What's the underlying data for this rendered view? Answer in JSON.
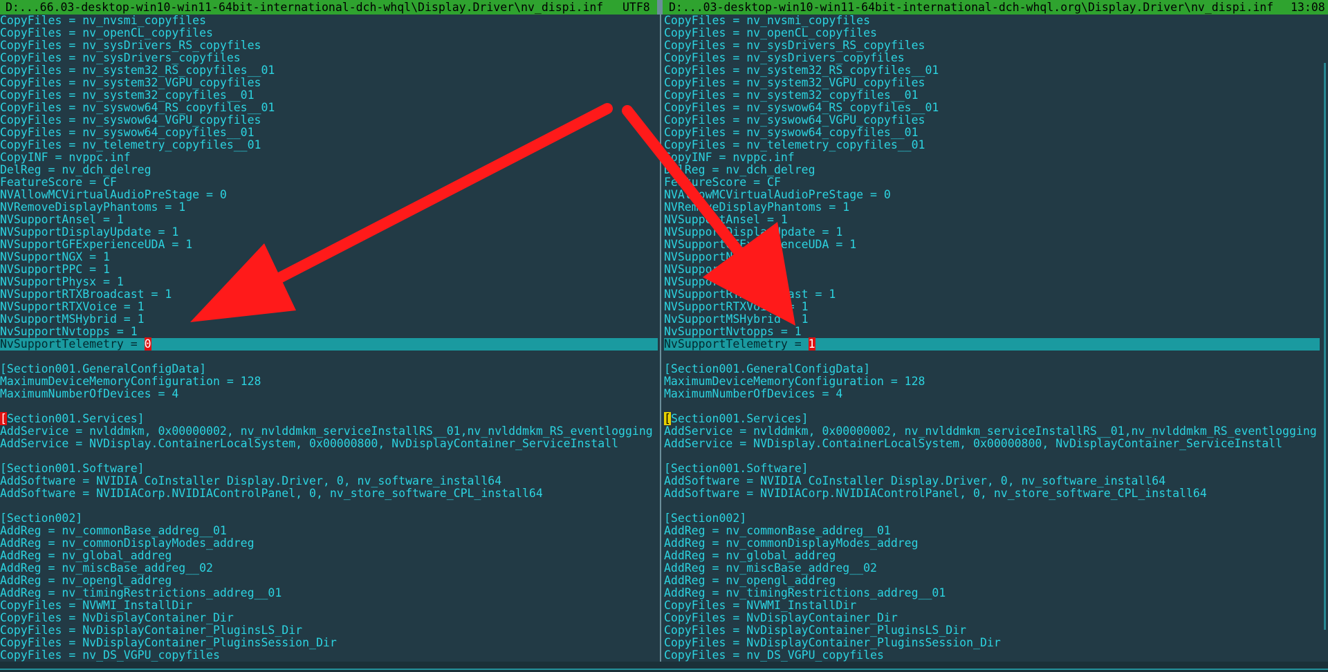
{
  "title_bar": {
    "left_path": "D:...66.03-desktop-win10-win11-64bit-international-dch-whql\\Display.Driver\\nv_dispi.inf",
    "encoding": "UTF8",
    "right_path": "D:...03-desktop-win10-win11-64bit-international-dch-whql.org\\Display.Driver\\nv_dispi.inf",
    "clock": "13:08"
  },
  "colors": {
    "text": "#2cd3e0",
    "background": "#223a45",
    "title_bar": "#2fa32f",
    "cursor_line": "#1a9aa0",
    "diff_mark": "#e01010",
    "cursor_mark": "#e6d000",
    "annotation_arrow": "#ff1a1a"
  },
  "annotation": "two red arrows pointing at the NvSupportTelemetry line in each pane",
  "left_pane": {
    "lines": [
      "CopyFiles = nv_nvsmi_copyfiles",
      "CopyFiles = nv_openCL_copyfiles",
      "CopyFiles = nv_sysDrivers_RS_copyfiles",
      "CopyFiles = nv_sysDrivers_copyfiles",
      "CopyFiles = nv_system32_RS_copyfiles__01",
      "CopyFiles = nv_system32_VGPU_copyfiles",
      "CopyFiles = nv_system32_copyfiles__01",
      "CopyFiles = nv_syswow64_RS_copyfiles__01",
      "CopyFiles = nv_syswow64_VGPU_copyfiles",
      "CopyFiles = nv_syswow64_copyfiles__01",
      "CopyFiles = nv_telemetry_copyfiles__01",
      "CopyINF = nvppc.inf",
      "DelReg = nv_dch_delreg",
      "FeatureScore = CF",
      "NVAllowMCVirtualAudioPreStage = 0",
      "NVRemoveDisplayPhantoms = 1",
      "NVSupportAnsel = 1",
      "NVSupportDisplayUpdate = 1",
      "NVSupportGFExperienceUDA = 1",
      "NVSupportNGX = 1",
      "NVSupportPPC = 1",
      "NVSupportPhysx = 1",
      "NVSupportRTXBroadcast = 1",
      "NVSupportRTXVoice = 1",
      "NvSupportMSHybrid = 1",
      "NvSupportNvtopps = 1",
      "NvSupportTelemetry = ",
      "",
      "[Section001.GeneralConfigData]",
      "MaximumDeviceMemoryConfiguration = 128",
      "MaximumNumberOfDevices = 4",
      "",
      "Section001.Services]",
      "AddService = nvlddmkm, 0x00000002, nv_nvlddmkm_serviceInstallRS__01,nv_nvlddmkm_RS_eventlogging",
      "AddService = NVDisplay.ContainerLocalSystem, 0x00000800, NvDisplayContainer_ServiceInstall",
      "",
      "[Section001.Software]",
      "AddSoftware = NVIDIA CoInstaller Display.Driver, 0, nv_software_install64",
      "AddSoftware = NVIDIACorp.NVIDIAControlPanel, 0, nv_store_software_CPL_install64",
      "",
      "[Section002]",
      "AddReg = nv_commonBase_addreg__01",
      "AddReg = nv_commonDisplayModes_addreg",
      "AddReg = nv_global_addreg",
      "AddReg = nv_miscBase_addreg__02",
      "AddReg = nv_opengl_addreg",
      "AddReg = nv_timingRestrictions_addreg__01",
      "CopyFiles = NVWMI_InstallDir",
      "CopyFiles = NvDisplayContainer_Dir",
      "CopyFiles = NvDisplayContainer_PluginsLS_Dir",
      "CopyFiles = NvDisplayContainer_PluginsSession_Dir",
      "CopyFiles = nv_DS_VGPU_copyfiles"
    ],
    "cursor_line": 26,
    "telemetry_value": "0",
    "section_bracket": "["
  },
  "right_pane": {
    "lines": [
      "CopyFiles = nv_nvsmi_copyfiles",
      "CopyFiles = nv_openCL_copyfiles",
      "CopyFiles = nv_sysDrivers_RS_copyfiles",
      "CopyFiles = nv_sysDrivers_copyfiles",
      "CopyFiles = nv_system32_RS_copyfiles__01",
      "CopyFiles = nv_system32_VGPU_copyfiles",
      "CopyFiles = nv_system32_copyfiles__01",
      "CopyFiles = nv_syswow64_RS_copyfiles__01",
      "CopyFiles = nv_syswow64_VGPU_copyfiles",
      "CopyFiles = nv_syswow64_copyfiles__01",
      "CopyFiles = nv_telemetry_copyfiles__01",
      "CopyINF = nvppc.inf",
      "DelReg = nv_dch_delreg",
      "FeatureScore = CF",
      "NVAllowMCVirtualAudioPreStage = 0",
      "NVRemoveDisplayPhantoms = 1",
      "NVSupportAnsel = 1",
      "NVSupportDisplayUpdate = 1",
      "NVSupportGFExperienceUDA = 1",
      "NVSupportNGX = 1",
      "NVSupportPPC = 1",
      "NVSupportPhysx = 1",
      "NVSupportRTXBroadcast = 1",
      "NVSupportRTXVoice = 1",
      "NvSupportMSHybrid = 1",
      "NvSupportNvtopps = 1",
      "NvSupportTelemetry = ",
      "",
      "[Section001.GeneralConfigData]",
      "MaximumDeviceMemoryConfiguration = 128",
      "MaximumNumberOfDevices = 4",
      "",
      "Section001.Services]",
      "AddService = nvlddmkm, 0x00000002, nv_nvlddmkm_serviceInstallRS__01,nv_nvlddmkm_RS_eventlogging",
      "AddService = NVDisplay.ContainerLocalSystem, 0x00000800, NvDisplayContainer_ServiceInstall",
      "",
      "[Section001.Software]",
      "AddSoftware = NVIDIA CoInstaller Display.Driver, 0, nv_software_install64",
      "AddSoftware = NVIDIACorp.NVIDIAControlPanel, 0, nv_store_software_CPL_install64",
      "",
      "[Section002]",
      "AddReg = nv_commonBase_addreg__01",
      "AddReg = nv_commonDisplayModes_addreg",
      "AddReg = nv_global_addreg",
      "AddReg = nv_miscBase_addreg__02",
      "AddReg = nv_opengl_addreg",
      "AddReg = nv_timingRestrictions_addreg__01",
      "CopyFiles = NVWMI_InstallDir",
      "CopyFiles = NvDisplayContainer_Dir",
      "CopyFiles = NvDisplayContainer_PluginsLS_Dir",
      "CopyFiles = NvDisplayContainer_PluginsSession_Dir",
      "CopyFiles = nv_DS_VGPU_copyfiles"
    ],
    "cursor_line": 26,
    "telemetry_value": "1",
    "section_bracket": "["
  }
}
